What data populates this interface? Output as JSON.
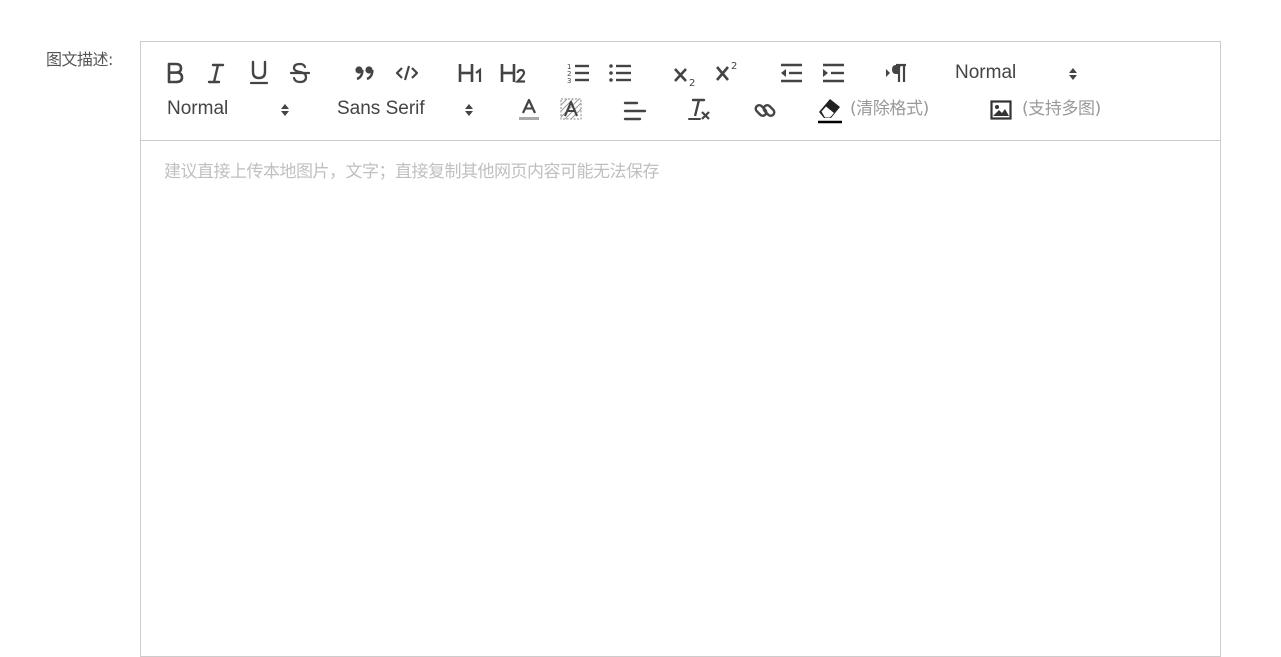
{
  "form": {
    "label": "图文描述:"
  },
  "toolbar": {
    "header_picker_value": "Normal",
    "size_picker_value": "Normal",
    "font_picker_value": "Sans Serif",
    "clear_format_hint": "(清除格式)",
    "image_hint": "(支持多图)",
    "h1_label": "H1",
    "h2_label": "H2"
  },
  "editor": {
    "placeholder": "建议直接上传本地图片，文字；直接复制其他网页内容可能无法保存"
  },
  "colors": {
    "border": "#cccccc",
    "icon": "#444444",
    "placeholder": "#c0c0c0",
    "hint": "#999999"
  },
  "icons": [
    "bold-icon",
    "italic-icon",
    "underline-icon",
    "strike-icon",
    "blockquote-icon",
    "code-block-icon",
    "header-1-icon",
    "header-2-icon",
    "ordered-list-icon",
    "bullet-list-icon",
    "subscript-icon",
    "superscript-icon",
    "outdent-icon",
    "indent-icon",
    "rtl-direction-icon",
    "font-color-icon",
    "background-color-icon",
    "align-left-icon",
    "clean-format-icon",
    "link-icon",
    "eraser-icon",
    "image-icon"
  ]
}
